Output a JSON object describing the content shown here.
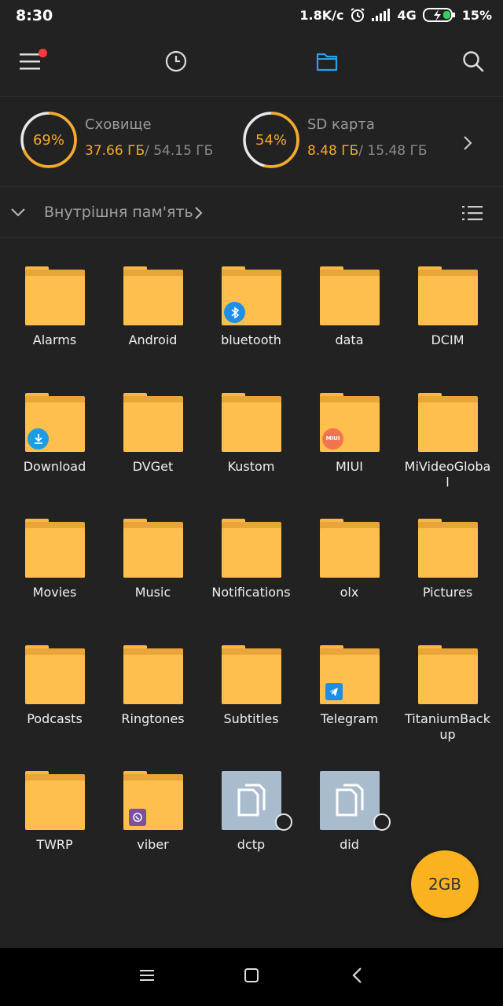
{
  "status_bar": {
    "time": "8:30",
    "speed": "1.8K/c",
    "network": "4G",
    "battery": "15%"
  },
  "toolbar": {
    "menu_icon": "hamburger-icon",
    "recent_icon": "clock-icon",
    "files_icon": "folder-icon",
    "search_icon": "search-icon",
    "active_color": "#2aa2e8"
  },
  "storage": {
    "internal": {
      "percent": "69%",
      "percent_value": 69,
      "name": "Сховище",
      "used": "37.66 ГБ",
      "total": "/ 54.15 ГБ"
    },
    "sd": {
      "percent": "54%",
      "percent_value": 54,
      "name": "SD карта",
      "used": "8.48 ГБ",
      "total": "/ 15.48 ГБ"
    }
  },
  "path": {
    "label": "Внутрішня пам'ять"
  },
  "items": [
    {
      "name": "Alarms",
      "type": "folder"
    },
    {
      "name": "Android",
      "type": "folder"
    },
    {
      "name": "bluetooth",
      "type": "folder",
      "badge": "bluetooth"
    },
    {
      "name": "data",
      "type": "folder"
    },
    {
      "name": "DCIM",
      "type": "folder"
    },
    {
      "name": "Download",
      "type": "folder",
      "badge": "download"
    },
    {
      "name": "DVGet",
      "type": "folder"
    },
    {
      "name": "Kustom",
      "type": "folder"
    },
    {
      "name": "MIUI",
      "type": "folder",
      "badge": "miui"
    },
    {
      "name": "MiVideoGloba\nl",
      "type": "folder"
    },
    {
      "name": "Movies",
      "type": "folder"
    },
    {
      "name": "Music",
      "type": "folder"
    },
    {
      "name": "Notifications",
      "type": "folder"
    },
    {
      "name": "olx",
      "type": "folder"
    },
    {
      "name": "Pictures",
      "type": "folder"
    },
    {
      "name": "Podcasts",
      "type": "folder"
    },
    {
      "name": "Ringtones",
      "type": "folder"
    },
    {
      "name": "Subtitles",
      "type": "folder"
    },
    {
      "name": "Telegram",
      "type": "folder",
      "badge": "telegram"
    },
    {
      "name": "TitaniumBack\nup",
      "type": "folder"
    },
    {
      "name": "TWRP",
      "type": "folder"
    },
    {
      "name": "viber",
      "type": "folder",
      "badge": "viber"
    },
    {
      "name": "dctp",
      "type": "file"
    },
    {
      "name": "did",
      "type": "file"
    }
  ],
  "badge_text": {
    "miui": "MIUI"
  },
  "fab": {
    "label": "2GB"
  }
}
